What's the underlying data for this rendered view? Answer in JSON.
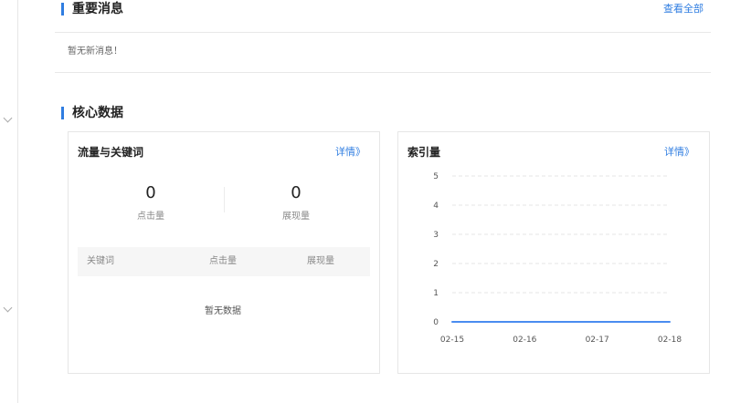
{
  "notice_section": {
    "title": "重要消息",
    "view_all": "查看全部",
    "empty_text": "暂无新消息！"
  },
  "core_section": {
    "title": "核心数据"
  },
  "traffic_card": {
    "title": "流量与关键词",
    "detail_link": "详情》",
    "stats": [
      {
        "value": "0",
        "label": "点击量"
      },
      {
        "value": "0",
        "label": "展现量"
      }
    ],
    "table": {
      "columns": [
        "关键词",
        "点击量",
        "展现量"
      ],
      "empty_text": "暂无数据"
    }
  },
  "index_card": {
    "title": "索引量",
    "detail_link": "详情》"
  },
  "chart_data": {
    "type": "line",
    "x": [
      "02-15",
      "02-16",
      "02-17",
      "02-18"
    ],
    "series": [
      {
        "values": [
          0,
          0,
          0,
          0
        ]
      }
    ],
    "yticks": [
      0,
      1,
      2,
      3,
      4,
      5
    ],
    "ylim": [
      0,
      5
    ],
    "grid": true,
    "line_color": "#4a8cf0"
  }
}
